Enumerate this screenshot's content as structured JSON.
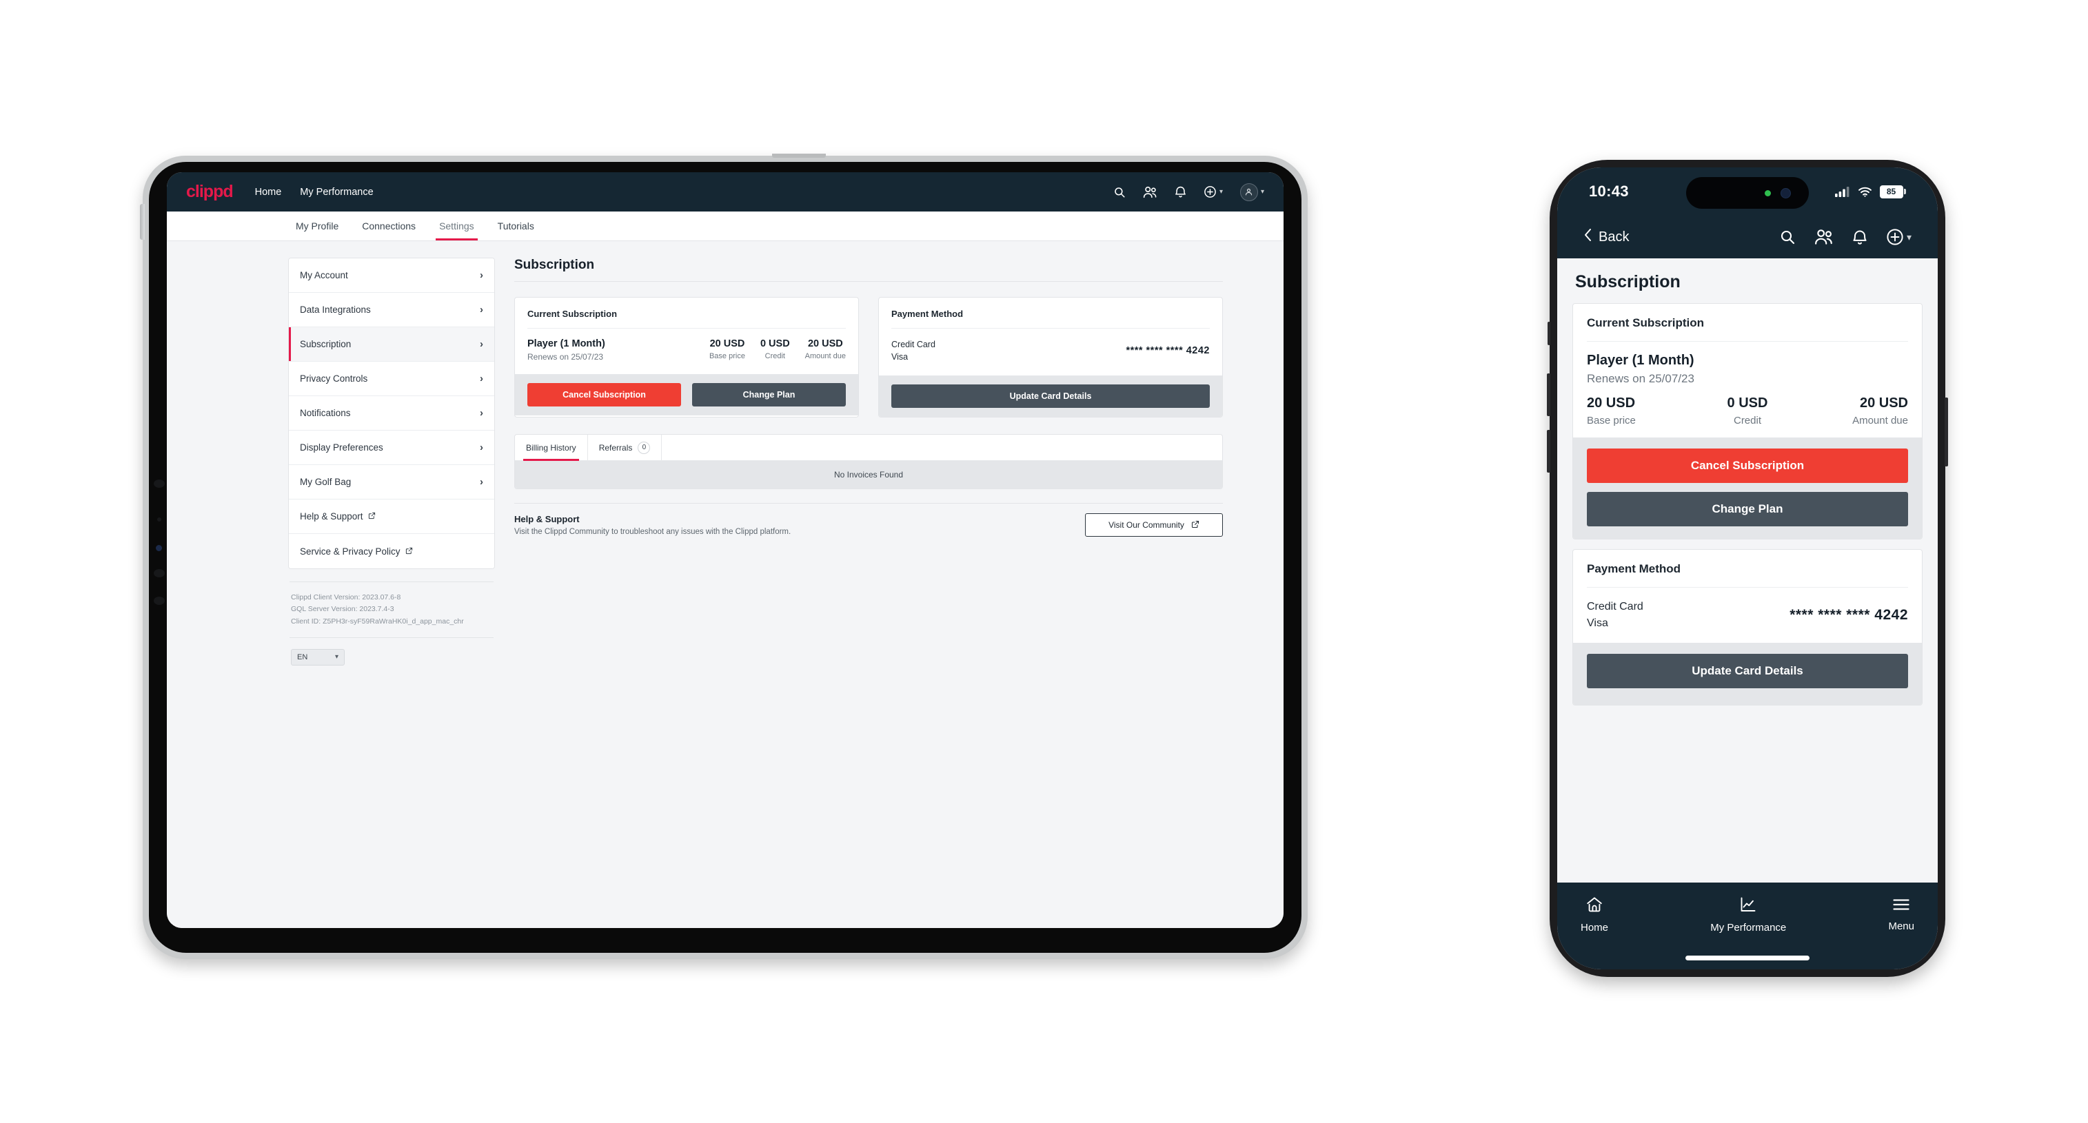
{
  "brand": {
    "name": "clippd",
    "accent": "#e4194a",
    "dark": "#152733",
    "danger": "#ef3e33",
    "slate": "#47525c"
  },
  "tablet": {
    "header": {
      "logo": "clippd",
      "nav": [
        "Home",
        "My Performance"
      ],
      "icons": [
        "search-icon",
        "people-icon",
        "bell-icon",
        "plus-circle-icon",
        "avatar-icon"
      ]
    },
    "tabs": [
      {
        "label": "My Profile",
        "active": false
      },
      {
        "label": "Connections",
        "active": false
      },
      {
        "label": "Settings",
        "active": true
      },
      {
        "label": "Tutorials",
        "active": false
      }
    ],
    "sidebar": {
      "items": [
        {
          "label": "My Account",
          "active": false,
          "external": false
        },
        {
          "label": "Data Integrations",
          "active": false,
          "external": false
        },
        {
          "label": "Subscription",
          "active": true,
          "external": false
        },
        {
          "label": "Privacy Controls",
          "active": false,
          "external": false
        },
        {
          "label": "Notifications",
          "active": false,
          "external": false
        },
        {
          "label": "Display Preferences",
          "active": false,
          "external": false
        },
        {
          "label": "My Golf Bag",
          "active": false,
          "external": false
        },
        {
          "label": "Help & Support",
          "active": false,
          "external": true
        },
        {
          "label": "Service & Privacy Policy",
          "active": false,
          "external": true
        }
      ],
      "versions": [
        "Clippd Client Version: 2023.07.6-8",
        "GQL Server Version: 2023.7.4-3",
        "Client ID: Z5PH3r-syF59RaWraHK0i_d_app_mac_chr"
      ],
      "language": "EN"
    },
    "main": {
      "title": "Subscription",
      "current_subscription": {
        "card_title": "Current Subscription",
        "plan_name": "Player (1 Month)",
        "renews": "Renews on 25/07/23",
        "figures": [
          {
            "value": "20 USD",
            "label": "Base price"
          },
          {
            "value": "0 USD",
            "label": "Credit"
          },
          {
            "value": "20 USD",
            "label": "Amount due"
          }
        ],
        "cancel_label": "Cancel Subscription",
        "change_label": "Change Plan"
      },
      "payment_method": {
        "card_title": "Payment Method",
        "type": "Credit Card",
        "brand": "Visa",
        "number": "**** **** **** 4242",
        "update_label": "Update Card Details"
      },
      "billing": {
        "tabs": [
          {
            "label": "Billing History",
            "badge": null,
            "active": true
          },
          {
            "label": "Referrals",
            "badge": "0",
            "active": false
          }
        ],
        "empty_text": "No Invoices Found"
      },
      "help": {
        "title": "Help & Support",
        "subtitle": "Visit the Clippd Community to troubleshoot any issues with the Clippd platform.",
        "button_label": "Visit Our Community"
      }
    }
  },
  "phone": {
    "status": {
      "time": "10:43",
      "battery": "85",
      "signal": "signal-icon",
      "wifi": "wifi-icon"
    },
    "navbar": {
      "back_label": "Back",
      "icons": [
        "search-icon",
        "people-icon",
        "bell-icon",
        "plus-circle-icon"
      ]
    },
    "title": "Subscription",
    "current_subscription": {
      "card_title": "Current Subscription",
      "plan_name": "Player (1 Month)",
      "renews": "Renews on 25/07/23",
      "figures": [
        {
          "value": "20 USD",
          "label": "Base price"
        },
        {
          "value": "0 USD",
          "label": "Credit"
        },
        {
          "value": "20 USD",
          "label": "Amount due"
        }
      ],
      "cancel_label": "Cancel Subscription",
      "change_label": "Change Plan"
    },
    "payment_method": {
      "card_title": "Payment Method",
      "type": "Credit Card",
      "brand": "Visa",
      "number": "**** **** **** 4242",
      "update_label": "Update Card Details"
    },
    "bottom_nav": [
      {
        "label": "Home",
        "icon": "home-icon"
      },
      {
        "label": "My Performance",
        "icon": "chart-line-icon"
      },
      {
        "label": "Menu",
        "icon": "hamburger-icon"
      }
    ]
  }
}
